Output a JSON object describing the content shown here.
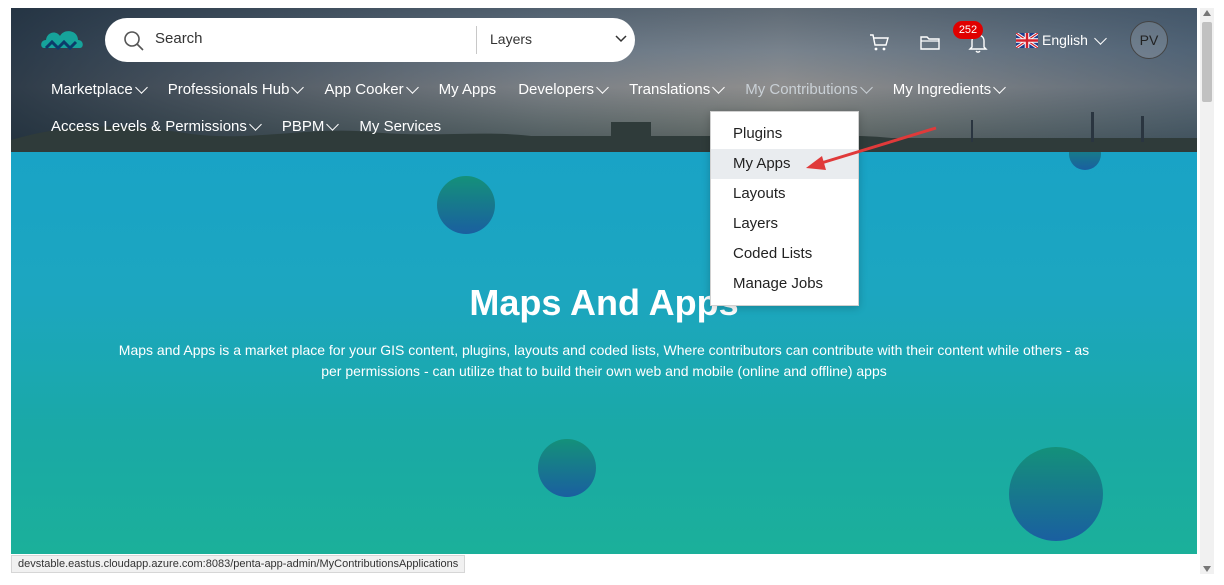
{
  "header": {
    "search": {
      "placeholder": "Search",
      "scope_value": "Layers"
    },
    "notifications": {
      "count": "252"
    },
    "language": "English",
    "user_initials": "PV",
    "nav_row1": [
      {
        "label": "Marketplace",
        "dropdown": true,
        "dim": false
      },
      {
        "label": "Professionals Hub",
        "dropdown": true,
        "dim": false
      },
      {
        "label": "App Cooker",
        "dropdown": true,
        "dim": false
      },
      {
        "label": "My Apps",
        "dropdown": false,
        "dim": false
      },
      {
        "label": "Developers",
        "dropdown": true,
        "dim": false
      },
      {
        "label": "Translations",
        "dropdown": true,
        "dim": false
      },
      {
        "label": "My Contributions",
        "dropdown": true,
        "dim": true
      },
      {
        "label": "My Ingredients",
        "dropdown": true,
        "dim": false
      }
    ],
    "nav_row2": [
      {
        "label": "Access Levels & Permissions",
        "dropdown": true
      },
      {
        "label": "PBPM",
        "dropdown": true
      },
      {
        "label": "My Services",
        "dropdown": false
      }
    ]
  },
  "contributions_menu": {
    "items": [
      "Plugins",
      "My Apps",
      "Layouts",
      "Layers",
      "Coded Lists",
      "Manage Jobs"
    ],
    "active_index": 1
  },
  "hero": {
    "title": "Maps And Apps",
    "description": "Maps and Apps is a market place for your GIS content, plugins, layouts and coded lists, Where contributors can contribute with their content while others - as per permissions - can utilize that to build their own web and mobile (online and offline) apps"
  },
  "status_bar": {
    "url": "devstable.eastus.cloudapp.azure.com:8083/penta-app-admin/MyContributionsApplications"
  },
  "colors": {
    "badge": "#e00000",
    "hero_top": "#19a3c6",
    "hero_bottom": "#1bb09a",
    "annotation_arrow": "#e03a3a"
  }
}
